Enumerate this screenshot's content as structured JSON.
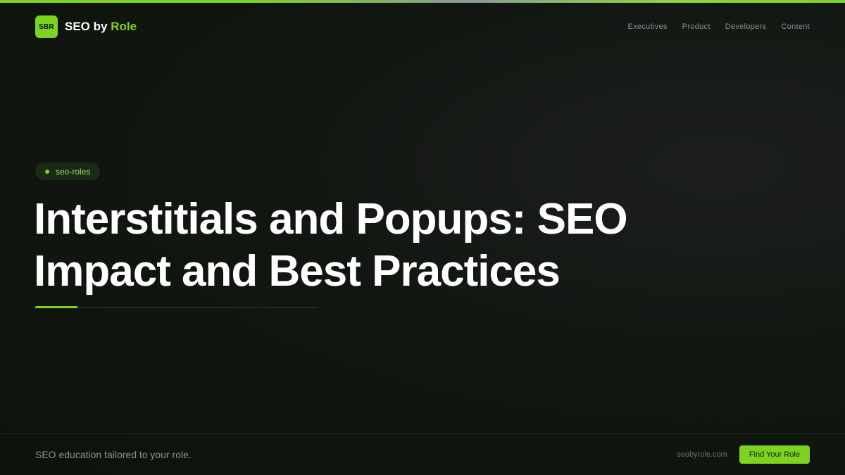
{
  "brand": {
    "logo_text": "SBR",
    "name_primary": "SEO by",
    "name_accent": "Role"
  },
  "nav": {
    "items": [
      {
        "label": "Executives"
      },
      {
        "label": "Product"
      },
      {
        "label": "Developers"
      },
      {
        "label": "Content"
      }
    ]
  },
  "hero": {
    "tag": "seo-roles",
    "title": "Interstitials and Popups: SEO Impact and Best Practices"
  },
  "footer": {
    "tagline": "SEO education tailored to your role.",
    "domain": "seobyrole.com",
    "cta_label": "Find Your Role"
  },
  "colors": {
    "accent": "#7ed321",
    "background": "#0f140f",
    "text": "#ffffff",
    "muted": "#8b8f8b"
  }
}
